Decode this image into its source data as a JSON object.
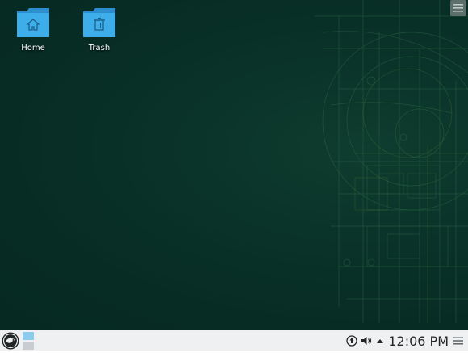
{
  "desktop": {
    "icons": [
      {
        "label": "Home",
        "icon": "folder-home-icon"
      },
      {
        "label": "Trash",
        "icon": "folder-trash-icon"
      }
    ],
    "toolbox_icon": "hamburger-menu-icon"
  },
  "panel": {
    "launcher_icon": "opensuse-logo-icon",
    "pager_icon": "virtual-desktop-pager",
    "tray_icons": [
      "updates-icon",
      "volume-icon",
      "expand-arrow-icon"
    ],
    "clock": "12:06 PM",
    "menu_icon": "hamburger-menu-icon"
  },
  "colors": {
    "desktop_bg": "#072c24",
    "panel_bg": "#eff0f1",
    "folder_blue": "#3daee9",
    "pager_active": "#8ccbee"
  }
}
